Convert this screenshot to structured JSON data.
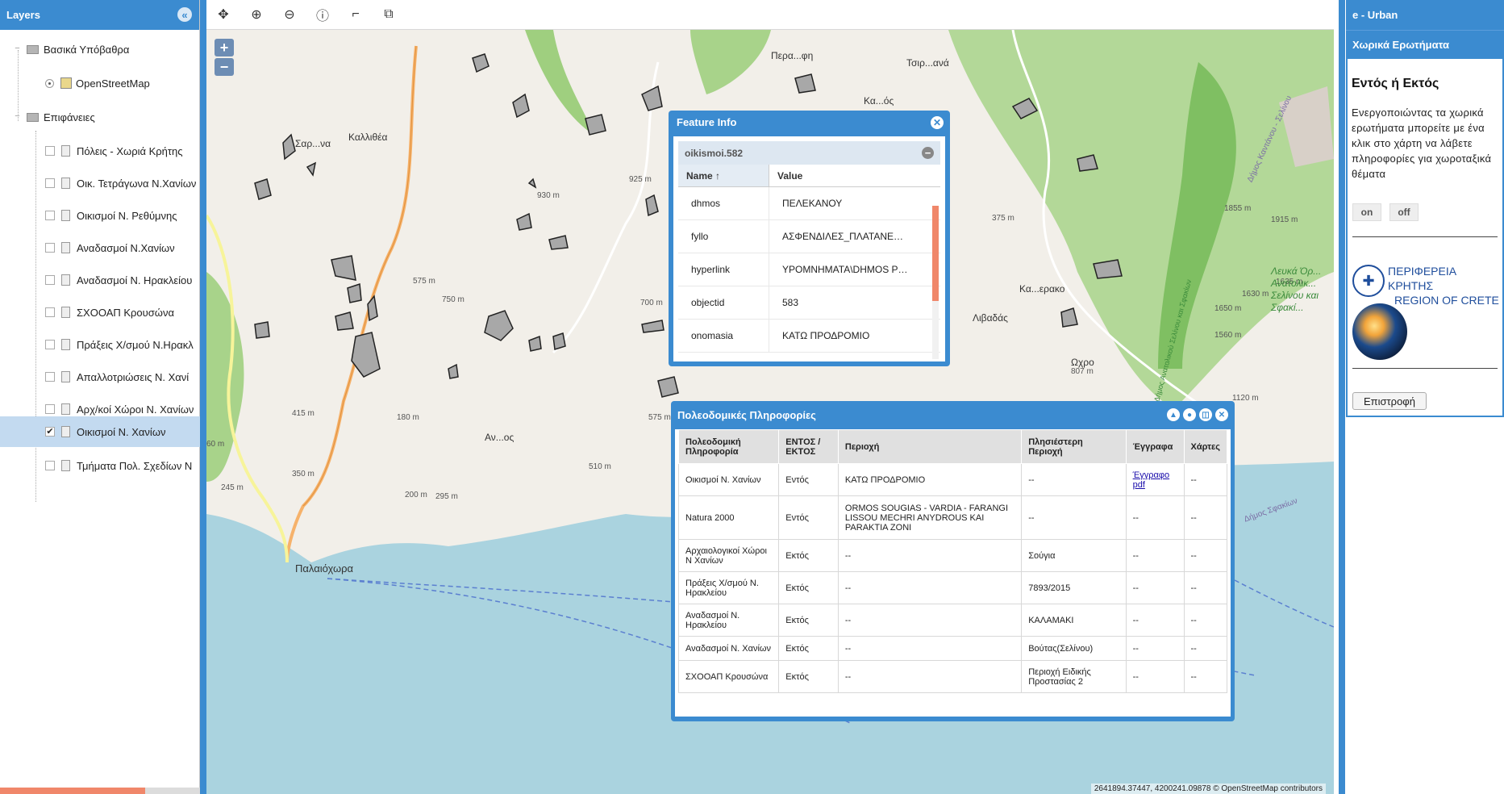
{
  "layers_panel": {
    "title": "Layers",
    "groups": [
      {
        "label": "Βασικά Υπόβαθρα",
        "items": [
          {
            "label": "OpenStreetMap",
            "type": "radio",
            "checked": true
          }
        ]
      },
      {
        "label": "Επιφάνειες",
        "items": [
          {
            "label": "Πόλεις - Χωριά Κρήτης",
            "checked": false
          },
          {
            "label": "Οικ. Τετράγωνα Ν.Χανίων",
            "checked": false
          },
          {
            "label": "Οικισμοί Ν. Ρεθύμνης",
            "checked": false
          },
          {
            "label": "Αναδασμοί Ν.Χανίων",
            "checked": false
          },
          {
            "label": "Αναδασμοί Ν. Ηρακλείου",
            "checked": false
          },
          {
            "label": "ΣΧΟΟΑΠ Κρουσώνα",
            "checked": false
          },
          {
            "label": "Πράξεις Χ/σμού Ν.Ηρακλ",
            "checked": false
          },
          {
            "label": "Απαλλοτριώσεις Ν. Χανί",
            "checked": false
          },
          {
            "label": "Αρχ/κοί Χώροι Ν. Χανίων",
            "checked": false
          },
          {
            "label": "Οικισμοί Ν. Χανίων",
            "checked": true,
            "selected": true
          },
          {
            "label": "Τμήματα Πολ. Σχεδίων Ν",
            "checked": false
          }
        ]
      }
    ]
  },
  "map": {
    "towns": [
      "Καλλιθέα",
      "Παλαιόχωρα",
      "Περα...φη",
      "Τσιρ...ανά",
      "Κα...ερακο",
      "Λιβαδάς",
      "Ωχρο",
      "Σαρ...να",
      "Αν...ος",
      "Κα...ός"
    ],
    "elevations": [
      "930 m",
      "925 m",
      "575 m",
      "750 m",
      "700 m",
      "415 m",
      "180 m",
      "575 m",
      "510 m",
      "350 m",
      "245 m",
      "200 m",
      "295 m",
      "375 m",
      "1855 m",
      "1915 m",
      "1635 m",
      "1630 m",
      "1650 m",
      "1560 m",
      "807 m",
      "1120 m",
      "60 m"
    ],
    "region_label": "Λευκά Όρ... Ανατολικ... Σελίνου και Σφακί...",
    "road_labels": [
      "Δήμος Καντάνου - Σελίνου",
      "Δήμος Σφακίων",
      "Δήμος Ανατολικού Σελίνου και Σφακίων"
    ],
    "attribution": "© OpenStreetMap contributors",
    "coordinates": "2641894.37447, 4200241.09878"
  },
  "toolbar": {
    "buttons": [
      "pan-icon",
      "zoom-in-icon",
      "zoom-out-icon",
      "info-icon",
      "measure-line-icon",
      "measure-area-icon"
    ]
  },
  "feature_info": {
    "title": "Feature Info",
    "feature_id": "oikismoi.582",
    "col_name": "Name",
    "col_value": "Value",
    "rows": [
      {
        "name": "dhmos",
        "value": "ΠΕΛΕΚΑΝΟΥ"
      },
      {
        "name": "fyllo",
        "value": "ΑΣΦΕΝΔΙΛΕΣ_ΠΛΑΤΑΝΕ…"
      },
      {
        "name": "hyperlink",
        "value": "ΥΡΟΜΝΗΜΑΤΑ\\DHMOS P…"
      },
      {
        "name": "objectid",
        "value": "583"
      },
      {
        "name": "onomasia",
        "value": "ΚΑΤΩ ΠΡΟΔΡΟΜΙΟ"
      }
    ]
  },
  "urban_info": {
    "title": "Πολεοδομικές Πληροφορίες",
    "headers": [
      "Πολεοδομική Πληροφορία",
      "ΕΝΤΟΣ / ΕΚΤΟΣ",
      "Περιοχή",
      "Πλησιέστερη Περιοχή",
      "Έγγραφα",
      "Χάρτες"
    ],
    "rows": [
      [
        "Οικισμοί Ν. Χανίων",
        "Εντός",
        "ΚΑΤΩ ΠΡΟΔΡΟΜΙΟ",
        "--",
        "Έγγραφο pdf",
        "--"
      ],
      [
        "Natura 2000",
        "Εντός",
        "ORMOS SOUGIAS - VARDIA - FARANGI LISSOU MECHRI ANYDROUS KAI PARAKTIA ZONI",
        "--",
        "--",
        "--"
      ],
      [
        "Αρχαιολογικοί Χώροι Ν Χανίων",
        "Εκτός",
        "--",
        "Σούγια",
        "--",
        "--"
      ],
      [
        "Πράξεις Χ/σμού Ν. Ηρακλείου",
        "Εκτός",
        "--",
        "7893/2015",
        "--",
        "--"
      ],
      [
        "Αναδασμοί Ν. Ηρακλείου",
        "Εκτός",
        "--",
        "ΚΑΛΑΜΑΚΙ",
        "--",
        "--"
      ],
      [
        "Αναδασμοί Ν. Χανίων",
        "Εκτός",
        "--",
        "Βούτας(Σελίνου)",
        "--",
        "--"
      ],
      [
        "ΣΧΟΟΑΠ Κρουσώνα",
        "Εκτός",
        "--",
        "Περιοχή Ειδικής Προστασίας 2",
        "--",
        "--"
      ]
    ]
  },
  "right_panel": {
    "app_title": "e - Urban",
    "section_title": "Χωρικά Ερωτήματα",
    "heading": "Εντός ή Εκτός",
    "description": "Ενεργοποιώντας τα χωρικά ερωτήματα μπορείτε με ένα κλικ στο χάρτη να λάβετε πληροφορίες για χωροταξικά θέματα",
    "on_label": "on",
    "off_label": "off",
    "logo_line1": "ΠΕΡΙΦΕΡΕΙΑ ΚΡΗΤΗΣ",
    "logo_line2": "REGION OF CRETE",
    "back_label": "Επιστροφή"
  },
  "colors": {
    "accent": "#3b8bd0",
    "sea": "#aad3df",
    "land": "#f2efe9",
    "forest": "#8dc56c",
    "scroll_thumb": "#f0876a"
  }
}
